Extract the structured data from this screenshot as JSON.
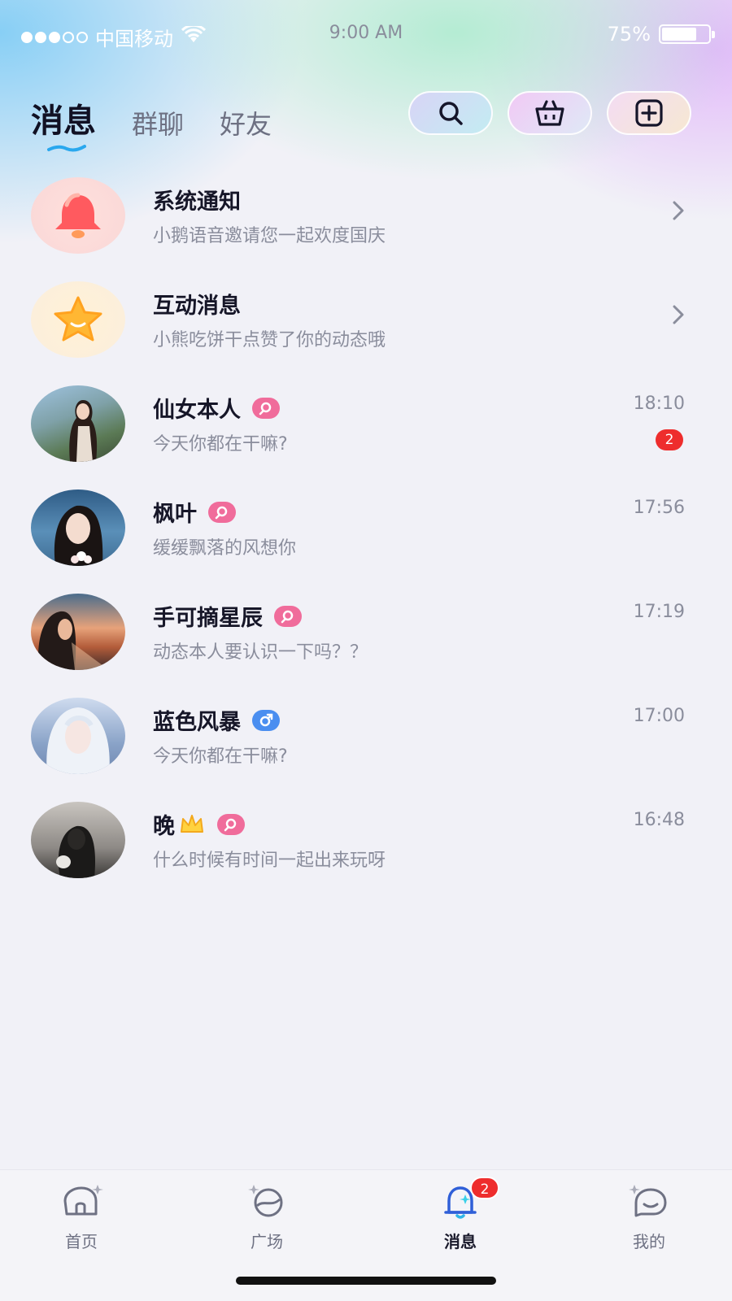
{
  "status_bar": {
    "carrier": "中国移动",
    "time": "9:00 AM",
    "battery": "75%",
    "battery_level": 0.75,
    "signal_strength": 3,
    "signal_max": 5
  },
  "header": {
    "tabs": [
      {
        "label": "消息",
        "active": true
      },
      {
        "label": "群聊",
        "active": false
      },
      {
        "label": "好友",
        "active": false
      }
    ],
    "actions": [
      "search-icon",
      "basket-icon",
      "add-icon"
    ]
  },
  "conversations": [
    {
      "type": "system",
      "name": "系统通知",
      "preview": "小鹅语音邀请您一起欢度国庆",
      "icon": "bell-icon"
    },
    {
      "type": "system",
      "name": "互动消息",
      "preview": "小熊吃饼干点赞了你的动态哦",
      "icon": "star-icon"
    },
    {
      "type": "user",
      "name": "仙女本人",
      "gender": "female",
      "time": "18:10",
      "preview": "今天你都在干嘛?",
      "unread": "2"
    },
    {
      "type": "user",
      "name": "枫叶",
      "gender": "female",
      "time": "17:56",
      "preview": "缓缓飘落的风想你"
    },
    {
      "type": "user",
      "name": "手可摘星辰",
      "gender": "female",
      "time": "17:19",
      "preview": "动态本人要认识一下吗？？"
    },
    {
      "type": "user",
      "name": "蓝色风暴",
      "gender": "male",
      "time": "17:00",
      "preview": "今天你都在干嘛?"
    },
    {
      "type": "user",
      "name": "晚",
      "gender": "female",
      "time": "16:48",
      "preview": "什么时候有时间一起出来玩呀"
    }
  ],
  "bottom_nav": [
    {
      "label": "首页",
      "icon": "home-icon"
    },
    {
      "label": "广场",
      "icon": "planet-icon"
    },
    {
      "label": "消息",
      "icon": "bell-icon",
      "active": true,
      "badge": "2"
    },
    {
      "label": "我的",
      "icon": "profile-icon"
    }
  ],
  "colors": {
    "unread_badge": "#ee2d2d",
    "female": "#f06c9b",
    "male": "#4a8ef0"
  }
}
